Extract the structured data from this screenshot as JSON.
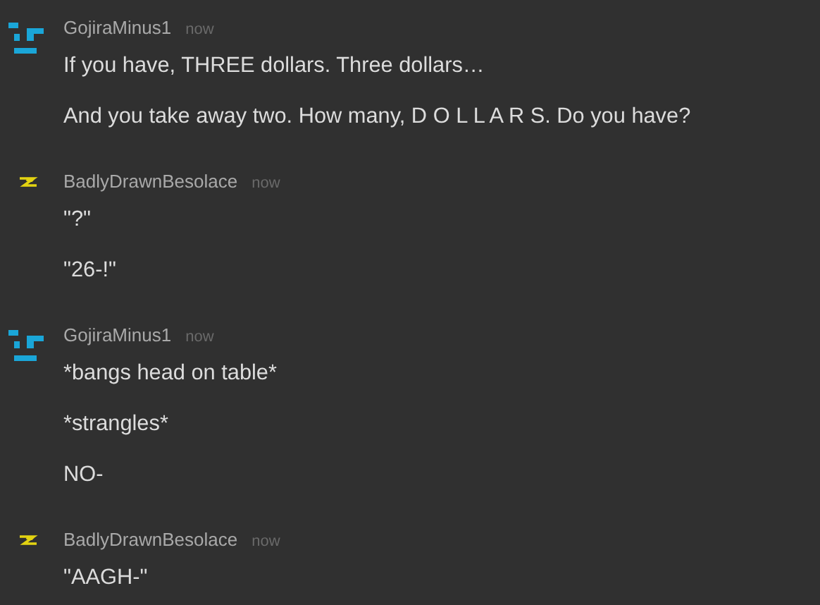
{
  "messages": [
    {
      "author": "GojiraMinus1",
      "time": "now",
      "kind": "blocks",
      "lines": [
        "If you have, THREE dollars. Three dollars…",
        "And you take away two. How many, D O L L A R S. Do you have?"
      ]
    },
    {
      "author": "BadlyDrawnBesolace",
      "time": "now",
      "kind": "bolt",
      "lines": [
        "\"?\"",
        "\"26-!\""
      ]
    },
    {
      "author": "GojiraMinus1",
      "time": "now",
      "kind": "blocks",
      "lines": [
        "*bangs head on table*",
        "*strangles*",
        "NO-"
      ]
    },
    {
      "author": "BadlyDrawnBesolace",
      "time": "now",
      "kind": "bolt",
      "lines": [
        "\"AAGH-\""
      ]
    }
  ]
}
